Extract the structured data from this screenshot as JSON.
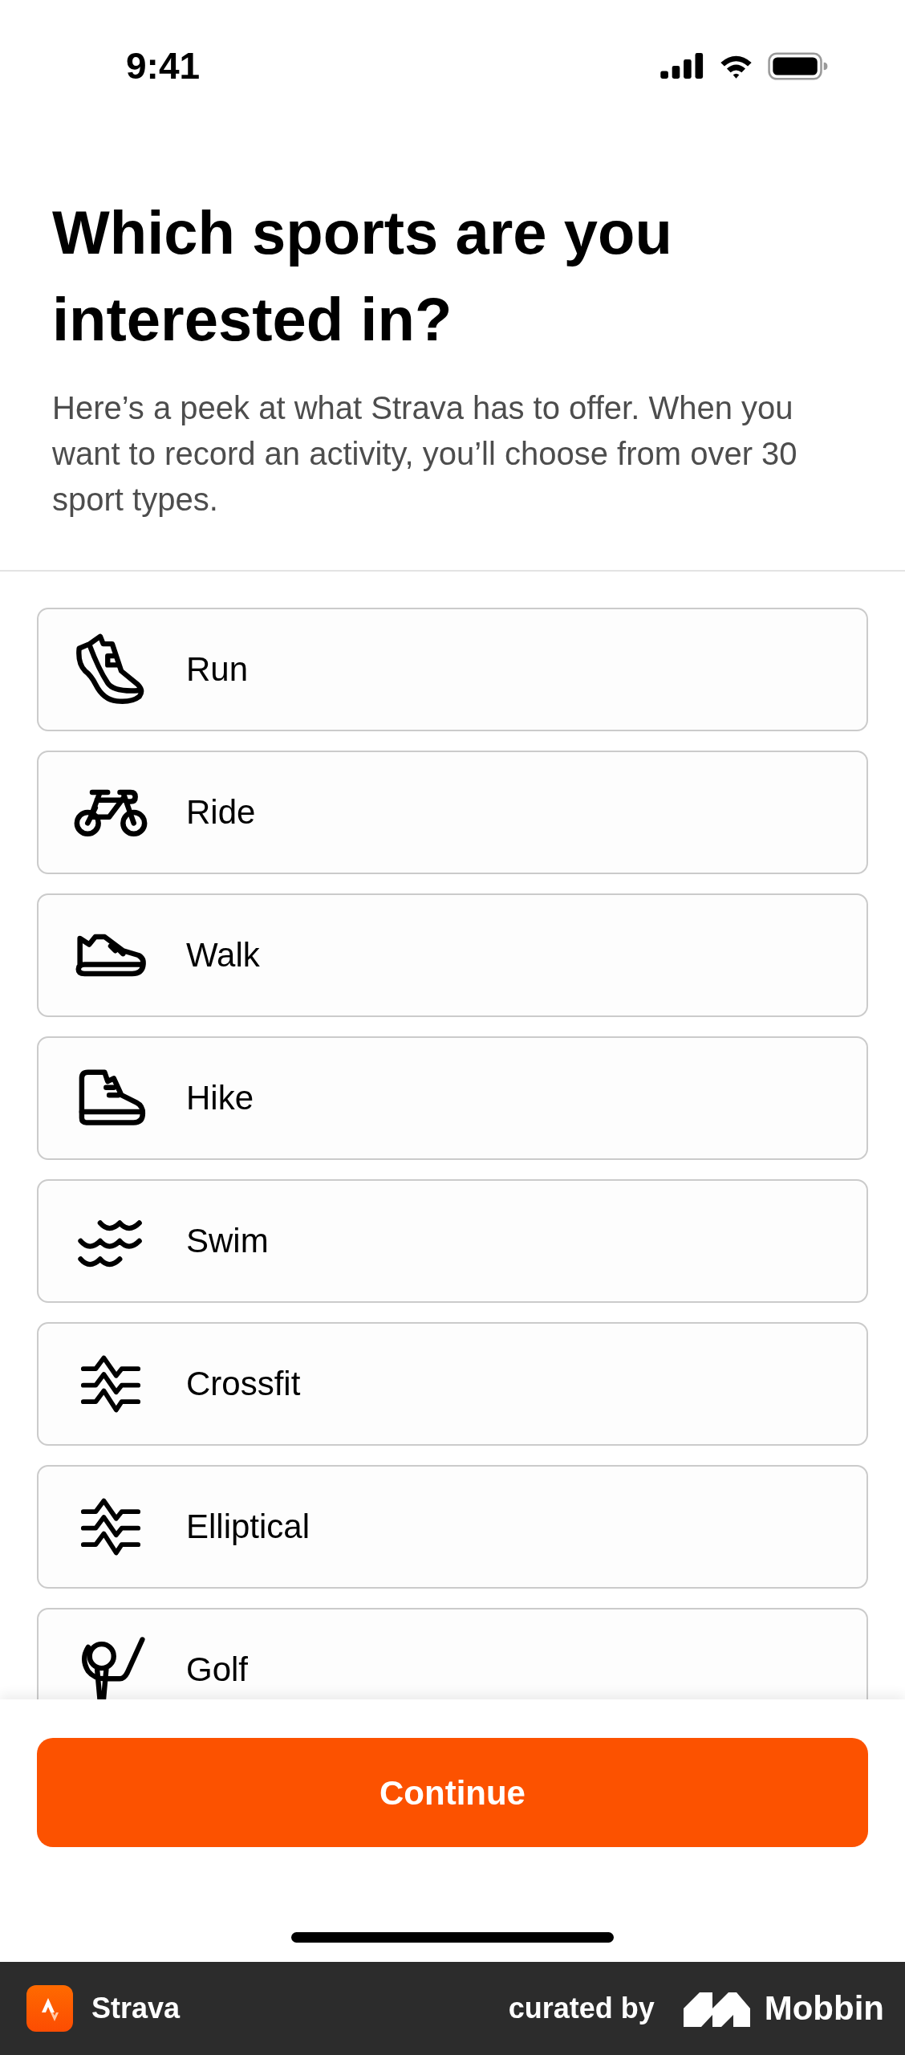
{
  "status_bar": {
    "time": "9:41"
  },
  "header": {
    "title": "Which sports are you interested in?",
    "description": "Here’s a peek at what Strava has to offer. When you want to record an activity, you’ll choose from over 30 sport types."
  },
  "sports": [
    {
      "kind": "run",
      "label": "Run",
      "selected": false
    },
    {
      "kind": "ride",
      "label": "Ride",
      "selected": false
    },
    {
      "kind": "walk",
      "label": "Walk",
      "selected": false
    },
    {
      "kind": "hike",
      "label": "Hike",
      "selected": false
    },
    {
      "kind": "swim",
      "label": "Swim",
      "selected": false
    },
    {
      "kind": "crossfit",
      "label": "Crossfit",
      "selected": false
    },
    {
      "kind": "elliptical",
      "label": "Elliptical",
      "selected": false
    },
    {
      "kind": "golf",
      "label": "Golf",
      "selected": false
    }
  ],
  "continue_button": {
    "label": "Continue"
  },
  "footer": {
    "app_name": "Strava",
    "curated_by": "curated by",
    "brand": "Mobbin"
  }
}
